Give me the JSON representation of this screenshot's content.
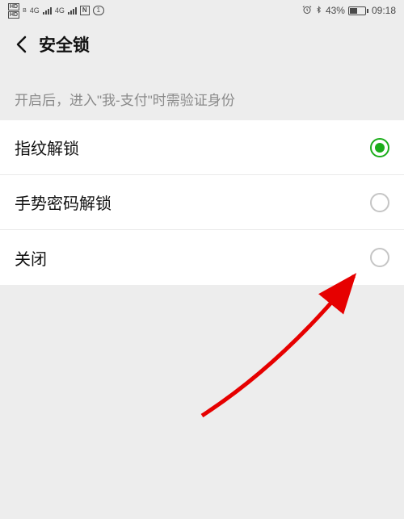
{
  "statusBar": {
    "hdLabel": "HD",
    "networkSup": "B",
    "netType": "4G",
    "nfc": "N",
    "simNumber": "1",
    "alarm": "⏰",
    "bluetooth": "✱",
    "batteryPercent": "43%",
    "time": "09:18"
  },
  "header": {
    "title": "安全锁"
  },
  "hintText": "开启后，进入\"我-支付\"时需验证身份",
  "options": [
    {
      "label": "指纹解锁",
      "selected": true
    },
    {
      "label": "手势密码解锁",
      "selected": false
    },
    {
      "label": "关闭",
      "selected": false
    }
  ]
}
